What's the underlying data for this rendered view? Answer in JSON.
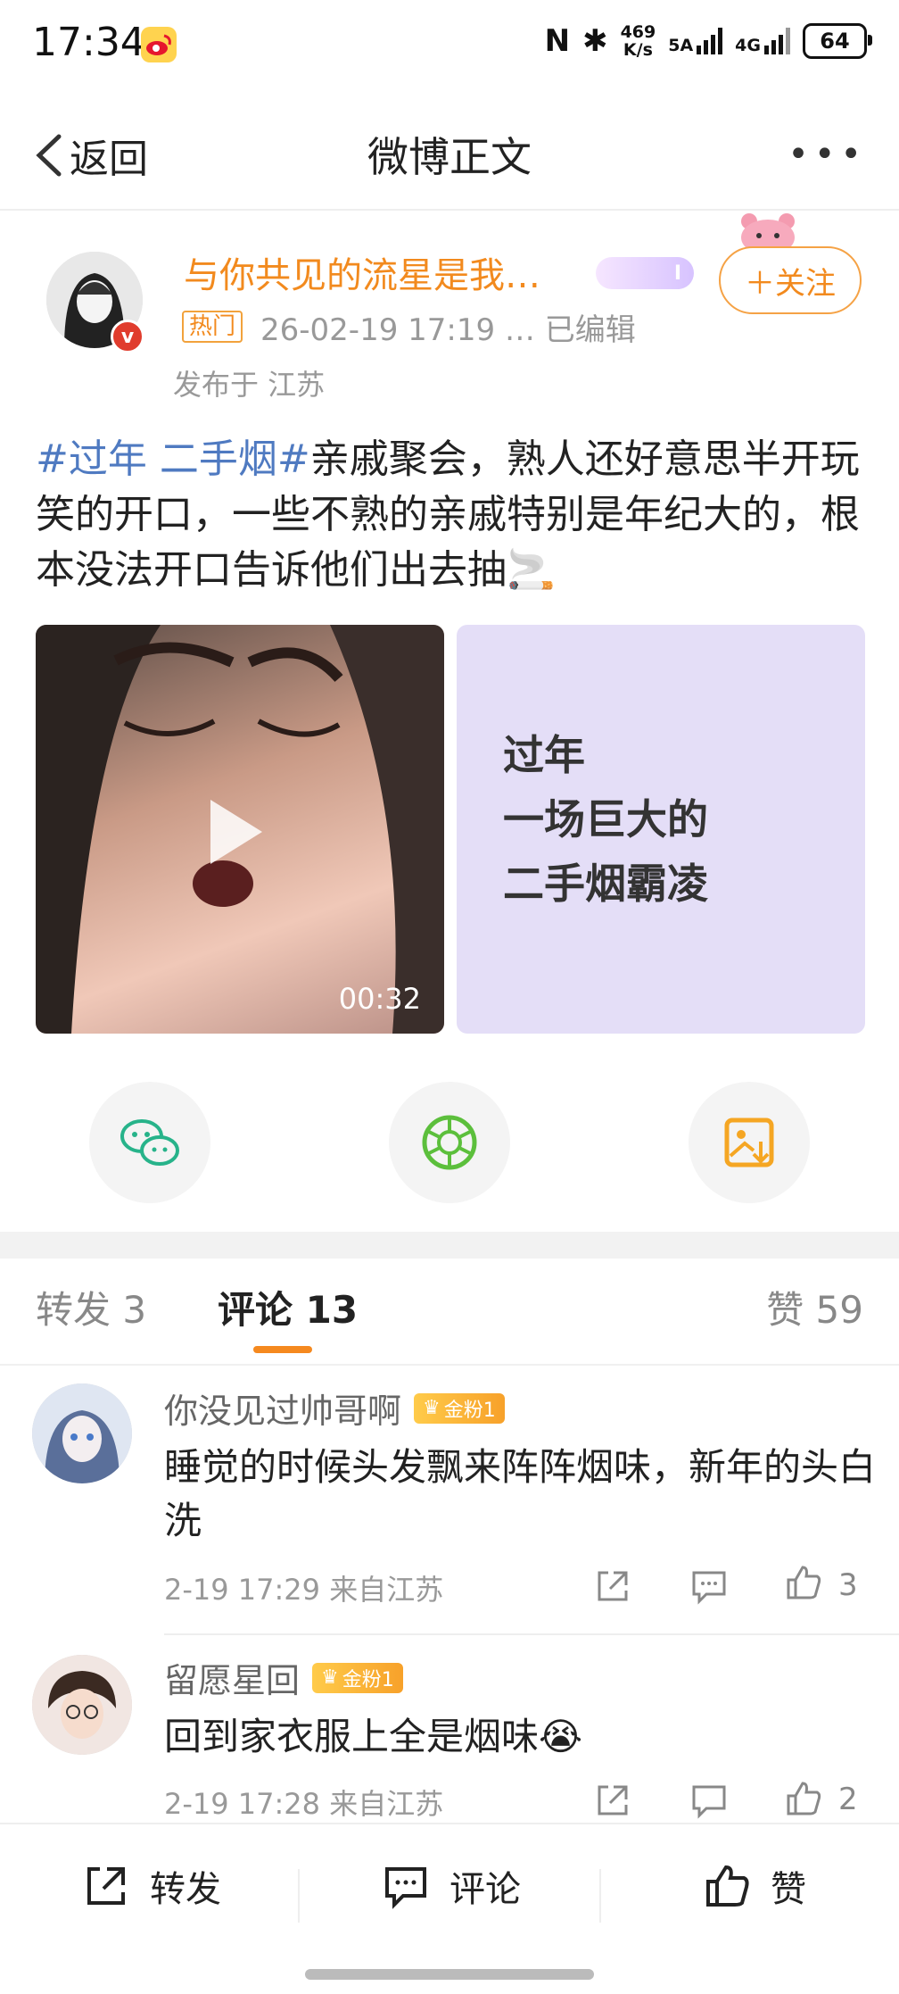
{
  "status_bar": {
    "time": "17:34",
    "net_speed_top": "469",
    "net_speed_bottom": "K/s",
    "sig1_label": "5A",
    "sig2_label": "4G",
    "battery": "64"
  },
  "nav": {
    "back_label": "返回",
    "title": "微博正文",
    "more": "•••"
  },
  "post": {
    "author": "与你共见的流星是我…",
    "author_badge": "I",
    "follow_label": "＋关注",
    "hot_tag": "热门",
    "time": "26-02-19 17:19 … 已编辑",
    "location": "发布于 江苏",
    "hashtag": "#过年 二手烟#",
    "text": "亲戚聚会，熟人还好意思半开玩笑的开口，一些不熟的亲戚特别是年纪大的，根本没法开口告诉他们出去抽🚬",
    "video_duration": "00:32",
    "image_line1": "过年",
    "image_line2": "一场巨大的",
    "image_line3": "二手烟霸凌"
  },
  "tabs": {
    "repost": "转发 3",
    "comment": "评论 13",
    "like": "赞 59"
  },
  "comments": [
    {
      "user": "你没见过帅哥啊",
      "badge": "金粉1",
      "text": "睡觉的时候头发飘来阵阵烟味，新年的头白洗",
      "meta": "2-19 17:29 来自江苏",
      "likes": "3"
    },
    {
      "user": "留愿星回",
      "badge": "金粉1",
      "text": "回到家衣服上全是烟味😭",
      "meta": "2-19 17:28 来自江苏",
      "likes": "2"
    }
  ],
  "bottom_bar": {
    "repost": "转发",
    "comment": "评论",
    "like": "赞"
  },
  "colors": {
    "accent_orange": "#f28a1e",
    "hashtag_blue": "#4f7ac1",
    "badge_gold": "#f7a12a"
  },
  "icons": [
    "weibo-icon",
    "nfc-icon",
    "bluetooth-icon",
    "back-chevron-icon",
    "wechat-icon",
    "moments-icon",
    "save-image-icon",
    "share-icon",
    "comment-icon",
    "like-icon",
    "play-icon"
  ]
}
